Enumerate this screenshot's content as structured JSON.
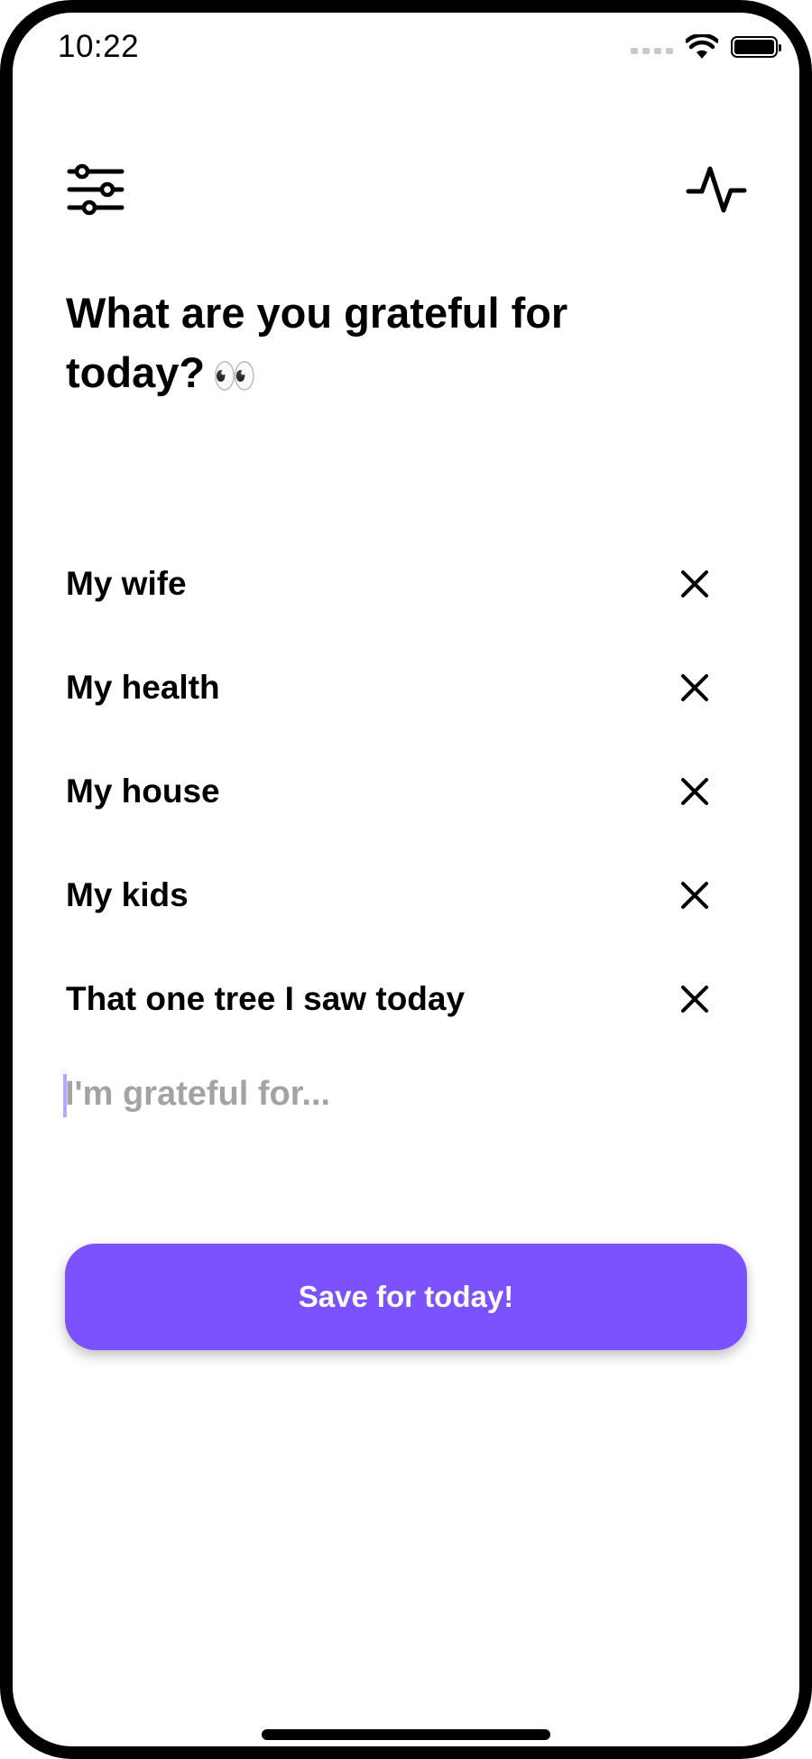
{
  "status_bar": {
    "time": "10:22",
    "icons": [
      "cellular-signal-icon",
      "wifi-icon",
      "battery-icon"
    ]
  },
  "header": {
    "left_icon": "sliders-icon",
    "right_icon": "activity-pulse-icon"
  },
  "question": {
    "text": "What are you grateful for today?",
    "emoji": "👀"
  },
  "gratitude_items": [
    {
      "label": "My wife",
      "remove_icon": "close-icon"
    },
    {
      "label": "My health",
      "remove_icon": "close-icon"
    },
    {
      "label": "My house",
      "remove_icon": "close-icon"
    },
    {
      "label": "My kids",
      "remove_icon": "close-icon"
    },
    {
      "label": "That one tree I saw today",
      "remove_icon": "close-icon"
    }
  ],
  "input": {
    "value": "",
    "placeholder": "I'm grateful for..."
  },
  "save_button": {
    "label": "Save for today!"
  },
  "colors": {
    "accent": "#7c52ff",
    "caret": "#b7a6ff",
    "placeholder": "#a3a3a3"
  }
}
